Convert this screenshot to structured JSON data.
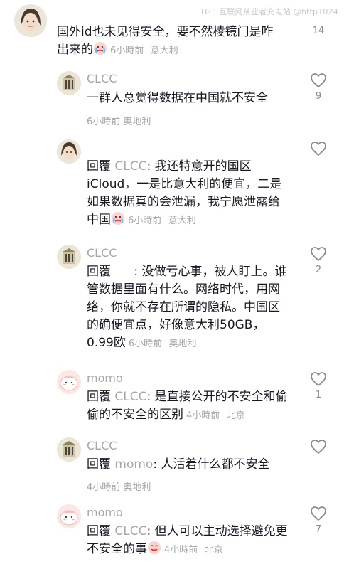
{
  "watermark": "TG：互联网从业者充电站 @http1024",
  "comments": [
    {
      "text1": "国外id也未见得安全，要不然棱镜门是咋",
      "text2": "出来的",
      "time": "6小時前",
      "location": "意大利",
      "likes": "14"
    },
    {
      "user": "CLCC",
      "text": "一群人总觉得数据在中国就不安全",
      "time": "6小時前",
      "location": "奥地利",
      "likes": "9"
    },
    {
      "reply": "回覆",
      "mention": "CLCC",
      "line1": ": 我还特意开的国区",
      "line2": "iCloud，一是比意大利的便宜，二是",
      "line3": "如果数据真的会泄漏，我宁愿泄露给",
      "line4": "中国",
      "time": "6小時前",
      "location": "意大利",
      "likes": ""
    },
    {
      "user": "CLCC",
      "reply": "回覆",
      "line1": "      : 没做亏心事，被人盯上。谁",
      "line2": "管数据里面有什么。网络时代，用网",
      "line3": "络，你就不存在所谓的隐私。中国区",
      "line4": "的确便宜点，好像意大利50GB，",
      "line5": "0.99欧",
      "time": "6小時前",
      "location": "奥地利",
      "likes": "2"
    },
    {
      "user": "momo",
      "reply": "回覆",
      "mention": "CLCC",
      "line1": ": 是直接公开的不安全和偷",
      "line2": "偷的不安全的区别",
      "time": "4小時前",
      "location": "北京",
      "likes": "1"
    },
    {
      "user": "CLCC",
      "reply": "回覆",
      "mention": "momo",
      "line1": ": 人活着什么都不安全",
      "time": "4小時前",
      "location": "奥地利",
      "likes": ""
    },
    {
      "user": "momo",
      "reply": "回覆",
      "mention": "CLCC",
      "line1": ": 但人可以主动选择避免更",
      "line2": "不安全的事",
      "time": "4小時前",
      "location": "北京",
      "likes": "7"
    }
  ]
}
